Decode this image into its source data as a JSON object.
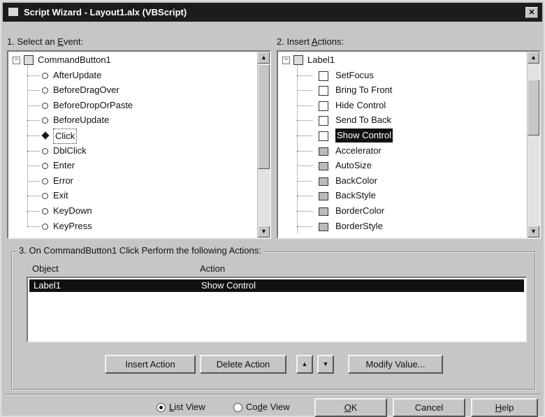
{
  "window": {
    "title": "Script Wizard - Layout1.alx (VBScript)",
    "close_glyph": "✕"
  },
  "events": {
    "label_prefix": "1. Select an ",
    "label_access": "E",
    "label_suffix": "vent:",
    "root": "CommandButton1",
    "items": [
      "AfterUpdate",
      "BeforeDragOver",
      "BeforeDropOrPaste",
      "BeforeUpdate",
      "Click",
      "DblClick",
      "Enter",
      "Error",
      "Exit",
      "KeyDown",
      "KeyPress"
    ],
    "selected": "Click"
  },
  "actions": {
    "label_prefix": "2. Insert ",
    "label_access": "A",
    "label_suffix": "ctions:",
    "root": "Label1",
    "methods": [
      "SetFocus",
      "Bring To Front",
      "Hide Control",
      "Send To Back",
      "Show Control"
    ],
    "properties": [
      "Accelerator",
      "AutoSize",
      "BackColor",
      "BackStyle",
      "BorderColor",
      "BorderStyle"
    ],
    "selected": "Show Control"
  },
  "perform": {
    "group_label": "3. On CommandButton1 Click Perform the following Actions:",
    "col_object": "Object",
    "col_action": "Action",
    "rows": [
      {
        "object": "Label1",
        "action": "Show Control"
      }
    ]
  },
  "buttons": {
    "insert_action": "Insert Action",
    "delete_action": "Delete Action",
    "move_up": "▲",
    "move_down": "▼",
    "modify_value": "Modify Value..."
  },
  "view": {
    "list_view_pre": "",
    "list_view_acc": "L",
    "list_view_post": "ist View",
    "code_view_pre": "Co",
    "code_view_acc": "d",
    "code_view_post": "e View",
    "selected": "list"
  },
  "footer": {
    "ok_acc": "O",
    "ok_post": "K",
    "cancel": "Cancel",
    "help_acc": "H",
    "help_post": "elp"
  },
  "scroll": {
    "up": "▲",
    "down": "▼"
  }
}
